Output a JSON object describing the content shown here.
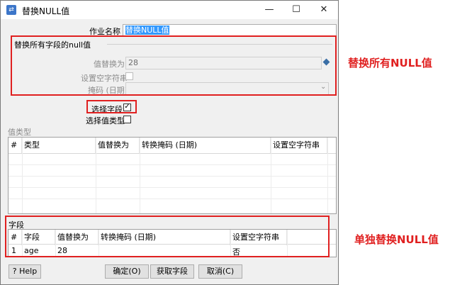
{
  "window": {
    "title": "替换NULL值",
    "minimize": "—",
    "maximize": "☐",
    "close": "✕"
  },
  "job_name": {
    "label": "作业名称",
    "value": "替换NULL值"
  },
  "all_fields_group": {
    "title": "替换所有字段的null值",
    "replace_with_label": "值替换为",
    "replace_with_value": "28",
    "empty_string_label": "设置空字符串",
    "mask_label": "掩码 (日期)",
    "mask_value": ""
  },
  "select_fields_label": "选择字段",
  "select_fields_checked": true,
  "select_value_type_label": "选择值类型",
  "select_value_type_checked": false,
  "value_type_section": {
    "title": "值类型",
    "columns": [
      "#",
      "类型",
      "值替换为",
      "转换掩码 (日期)",
      "设置空字符串"
    ]
  },
  "fields_section": {
    "title": "字段",
    "columns": [
      "#",
      "字段",
      "值替换为",
      "转换掩码 (日期)",
      "设置空字符串"
    ],
    "rows": [
      [
        "1",
        "age",
        "28",
        "",
        "否"
      ]
    ]
  },
  "buttons": {
    "help": "Help",
    "ok": "确定(O)",
    "get_fields": "获取字段",
    "cancel": "取消(C)"
  },
  "annotations": {
    "replace_all": "替换所有NULL值",
    "replace_single": "单独替换NULL值"
  },
  "colors": {
    "highlight_red": "#e02020",
    "selected_blue": "#3399ff"
  }
}
